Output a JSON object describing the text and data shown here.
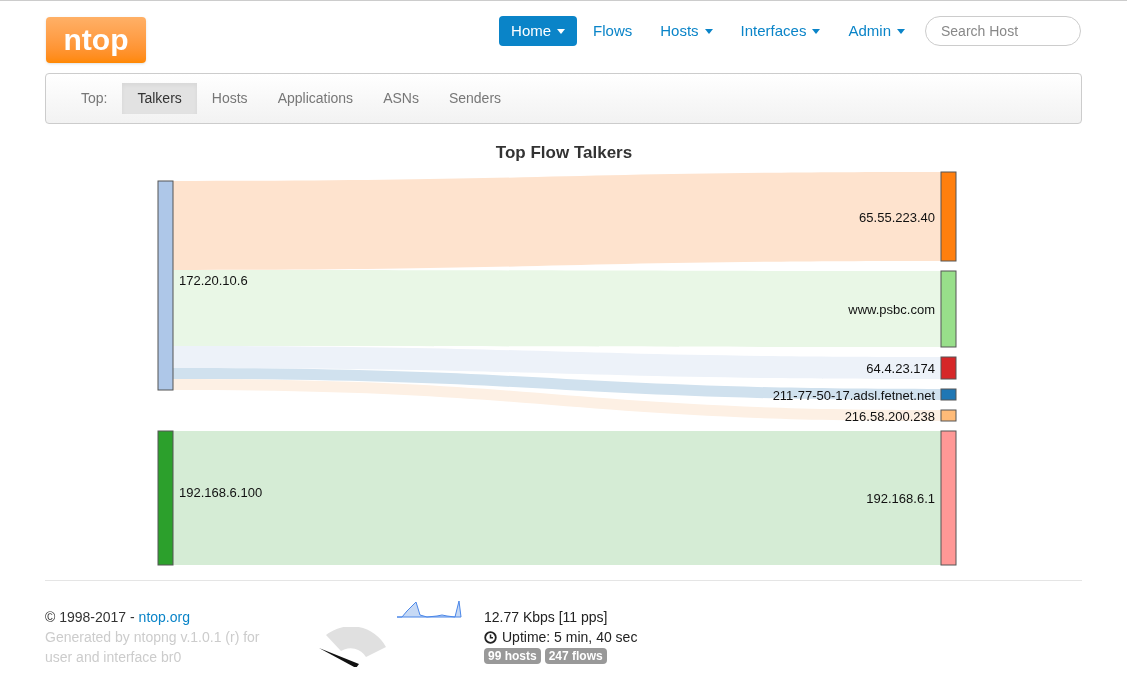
{
  "logo": {
    "text": "ntop"
  },
  "nav": {
    "items": [
      {
        "label": "Home",
        "selected": true,
        "dropdown": true
      },
      {
        "label": "Flows",
        "selected": false,
        "dropdown": false
      },
      {
        "label": "Hosts",
        "selected": false,
        "dropdown": true
      },
      {
        "label": "Interfaces",
        "selected": false,
        "dropdown": true
      },
      {
        "label": "Admin",
        "selected": false,
        "dropdown": true
      }
    ],
    "search": {
      "placeholder": "Search Host"
    }
  },
  "subnav": {
    "label": "Top:",
    "tabs": [
      {
        "label": "Talkers",
        "selected": true
      },
      {
        "label": "Hosts",
        "selected": false
      },
      {
        "label": "Applications",
        "selected": false
      },
      {
        "label": "ASNs",
        "selected": false
      },
      {
        "label": "Senders",
        "selected": false
      }
    ]
  },
  "sankey": {
    "title": "Top Flow Talkers",
    "sources": [
      {
        "label": "172.20.10.6",
        "color": "#aec7e8",
        "targets": [
          {
            "label": "65.55.223.40",
            "color": "#ff7f0e",
            "link": {
              "color": "#fee3ce"
            }
          },
          {
            "label": "www.psbc.com",
            "color": "#98df8a",
            "link": {
              "color": "#e9f7e6"
            }
          },
          {
            "label": "64.4.23.174",
            "color": "#d62728",
            "link": {
              "color": "#edf2f9"
            }
          },
          {
            "label": "211-77-50-17.adsl.fetnet.net",
            "color": "#1f77b4",
            "link": {
              "color": "#d0e1ee"
            }
          },
          {
            "label": "216.58.200.238",
            "color": "#ffbb78",
            "link": {
              "color": "#fdf0e4"
            }
          }
        ]
      },
      {
        "label": "192.168.6.100",
        "color": "#2ca02c",
        "targets": [
          {
            "label": "192.168.6.1",
            "color": "#ff9896",
            "link": {
              "color": "#d5ecd5"
            }
          }
        ]
      }
    ]
  },
  "footer": {
    "copyright": "© 1998-2017 - ",
    "link": "ntop.org",
    "generated": "Generated by ntopng v.1.0.1 (r) for user and interface br0",
    "throughput": "12.77 Kbps [11 pps]",
    "uptime": "Uptime: 5 min, 40 sec",
    "badges": [
      "99 hosts",
      "247 flows"
    ]
  }
}
